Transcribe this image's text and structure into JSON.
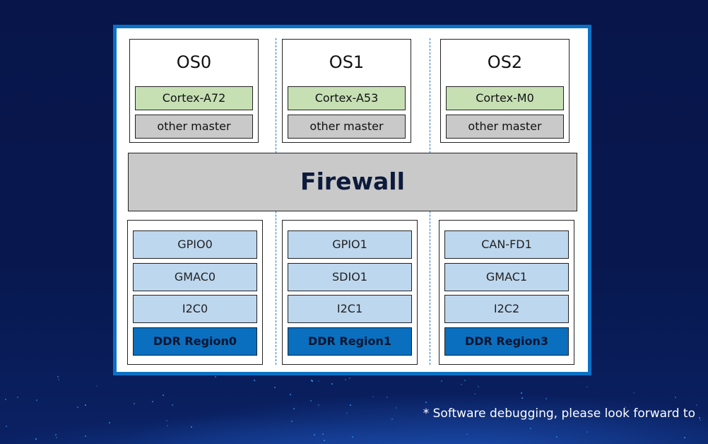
{
  "diagram": {
    "os_columns": [
      {
        "title": "OS0",
        "cpu": "Cortex-A72",
        "master": "other master"
      },
      {
        "title": "OS1",
        "cpu": "Cortex-A53",
        "master": "other master"
      },
      {
        "title": "OS2",
        "cpu": "Cortex-M0",
        "master": "other master"
      }
    ],
    "firewall_label": "Firewall",
    "peripheral_columns": [
      {
        "items": [
          "GPIO0",
          "GMAC0",
          "I2C0"
        ],
        "ddr": "DDR Region0"
      },
      {
        "items": [
          "GPIO1",
          "SDIO1",
          "I2C1"
        ],
        "ddr": "DDR Region1"
      },
      {
        "items": [
          "CAN-FD1",
          "GMAC1",
          "I2C2"
        ],
        "ddr": "DDR Region3"
      }
    ],
    "colors": {
      "frame_border": "#0a72c6",
      "cpu_fill": "#c6e0b4",
      "master_fill": "#c9c9c9",
      "firewall_fill": "#c9c9c9",
      "peripheral_fill": "#bdd7ee",
      "ddr_fill": "#0a6fbf",
      "background": "#08184f"
    }
  },
  "footnote": "* Software debugging, please look forward to"
}
